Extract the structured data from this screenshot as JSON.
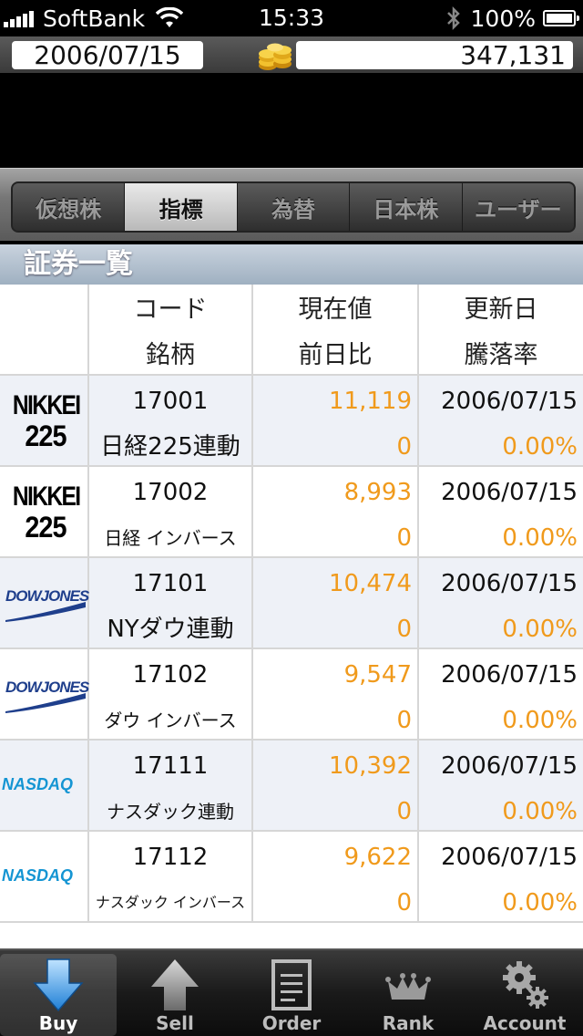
{
  "status_bar": {
    "carrier": "SoftBank",
    "time": "15:33",
    "battery": "100%",
    "signal_icon": "signal-bars-icon",
    "wifi_icon": "wifi-icon",
    "bluetooth_icon": "bluetooth-icon",
    "battery_icon": "battery-icon"
  },
  "info_bar": {
    "date": "2006/07/15",
    "money": "347,131",
    "money_icon": "gold-coins-icon"
  },
  "segments": [
    {
      "label": "仮想株",
      "active": false
    },
    {
      "label": "指標",
      "active": true
    },
    {
      "label": "為替",
      "active": false
    },
    {
      "label": "日本株",
      "active": false
    },
    {
      "label": "ユーザー",
      "active": false
    }
  ],
  "section": {
    "title": "証券一覧"
  },
  "table": {
    "headers": {
      "code": "コード",
      "name": "銘柄",
      "price": "現在値",
      "change": "前日比",
      "updated": "更新日",
      "rate": "騰落率"
    },
    "rows": [
      {
        "logo": "NIKKEI 225",
        "logo_lines": [
          "NIKKEI",
          "225"
        ],
        "code": "17001",
        "name": "日経225連動",
        "price": "11,119",
        "change": "0",
        "date": "2006/07/15",
        "rate": "0.00%"
      },
      {
        "logo": "NIKKEI 225",
        "logo_lines": [
          "NIKKEI",
          "225"
        ],
        "code": "17002",
        "name": "日経 インバース",
        "price": "8,993",
        "change": "0",
        "date": "2006/07/15",
        "rate": "0.00%"
      },
      {
        "logo": "DOWJONES",
        "logo_lines": [
          "DOWJONES"
        ],
        "code": "17101",
        "name": "NYダウ連動",
        "price": "10,474",
        "change": "0",
        "date": "2006/07/15",
        "rate": "0.00%"
      },
      {
        "logo": "DOWJONES",
        "logo_lines": [
          "DOWJONES"
        ],
        "code": "17102",
        "name": "ダウ インバース",
        "price": "9,547",
        "change": "0",
        "date": "2006/07/15",
        "rate": "0.00%"
      },
      {
        "logo": "NASDAQ",
        "logo_lines": [
          "NASDAQ"
        ],
        "code": "17111",
        "name": "ナスダック連動",
        "price": "10,392",
        "change": "0",
        "date": "2006/07/15",
        "rate": "0.00%"
      },
      {
        "logo": "NASDAQ",
        "logo_lines": [
          "NASDAQ"
        ],
        "code": "17112",
        "name": "ナスダック インバース",
        "price": "9,622",
        "change": "0",
        "date": "2006/07/15",
        "rate": "0.00%"
      }
    ]
  },
  "tab_bar": [
    {
      "label": "Buy",
      "icon": "down-arrow-icon",
      "active": true
    },
    {
      "label": "Sell",
      "icon": "up-arrow-icon",
      "active": false
    },
    {
      "label": "Order",
      "icon": "document-icon",
      "active": false
    },
    {
      "label": "Rank",
      "icon": "crown-icon",
      "active": false
    },
    {
      "label": "Account",
      "icon": "gears-icon",
      "active": false
    }
  ],
  "colors": {
    "accent_orange": "#f09a1c",
    "buy_arrow_blue": "#2a8fe0",
    "row_alt": "#eef1f7"
  }
}
